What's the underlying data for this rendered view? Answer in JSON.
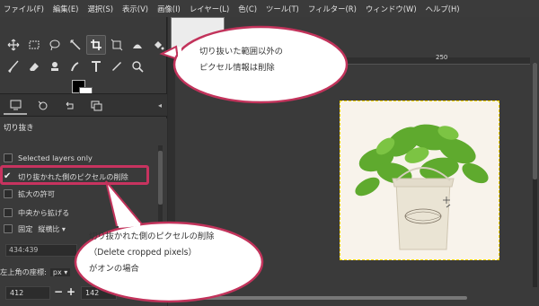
{
  "menubar": {
    "items": [
      "ファイル(F)",
      "編集(E)",
      "選択(S)",
      "表示(V)",
      "画像(I)",
      "レイヤー(L)",
      "色(C)",
      "ツール(T)",
      "フィルター(R)",
      "ウィンドウ(W)",
      "ヘルプ(H)"
    ]
  },
  "toolbox": {
    "tools_row1": [
      "move-icon",
      "rect-select-icon",
      "lasso-icon",
      "fuzzy-select-icon",
      "crop-icon",
      "transform-icon",
      "warp-icon",
      "bucket-fill-icon"
    ],
    "tools_row2": [
      "paintbrush-icon",
      "eraser-icon",
      "clone-icon",
      "smudge-icon",
      "text-icon",
      "color-picker-icon",
      "zoom-icon"
    ],
    "active_tool": "crop-icon",
    "foreground_color": "#000000",
    "background_color": "#ffffff"
  },
  "dock_tabs": [
    "tool-options-icon",
    "device-status-icon",
    "undo-history-icon",
    "images-icon"
  ],
  "tool_options": {
    "title": "切り抜き",
    "selected_layers_only": "Selected layers only",
    "delete_cropped_pixels": "切り抜かれた側のピクセルの削除",
    "allow_growing": "拡大の許可",
    "expand_from_center": "中央から拡げる",
    "fixed_label": "固定",
    "fixed_value": "縦横比",
    "ratio_value": "434:439",
    "position_label": "左上角の座標:",
    "unit_value": "px",
    "position_x": "412",
    "position_y": "142",
    "minus": "−",
    "plus": "+"
  },
  "canvas": {
    "ruler_mark": "250",
    "image_alt_text": "Beautiful Garden"
  },
  "callouts": {
    "top": [
      "切り抜いた範囲以外の",
      "ピクセル情報は削除"
    ],
    "bottom": [
      "切り抜かれた側のピクセルの削除",
      "（Delete cropped pixels）",
      "がオンの場合"
    ]
  },
  "colors": {
    "highlight": "#c7335f",
    "callout_border": "#c2335b",
    "callout_fill": "#ffffff"
  }
}
